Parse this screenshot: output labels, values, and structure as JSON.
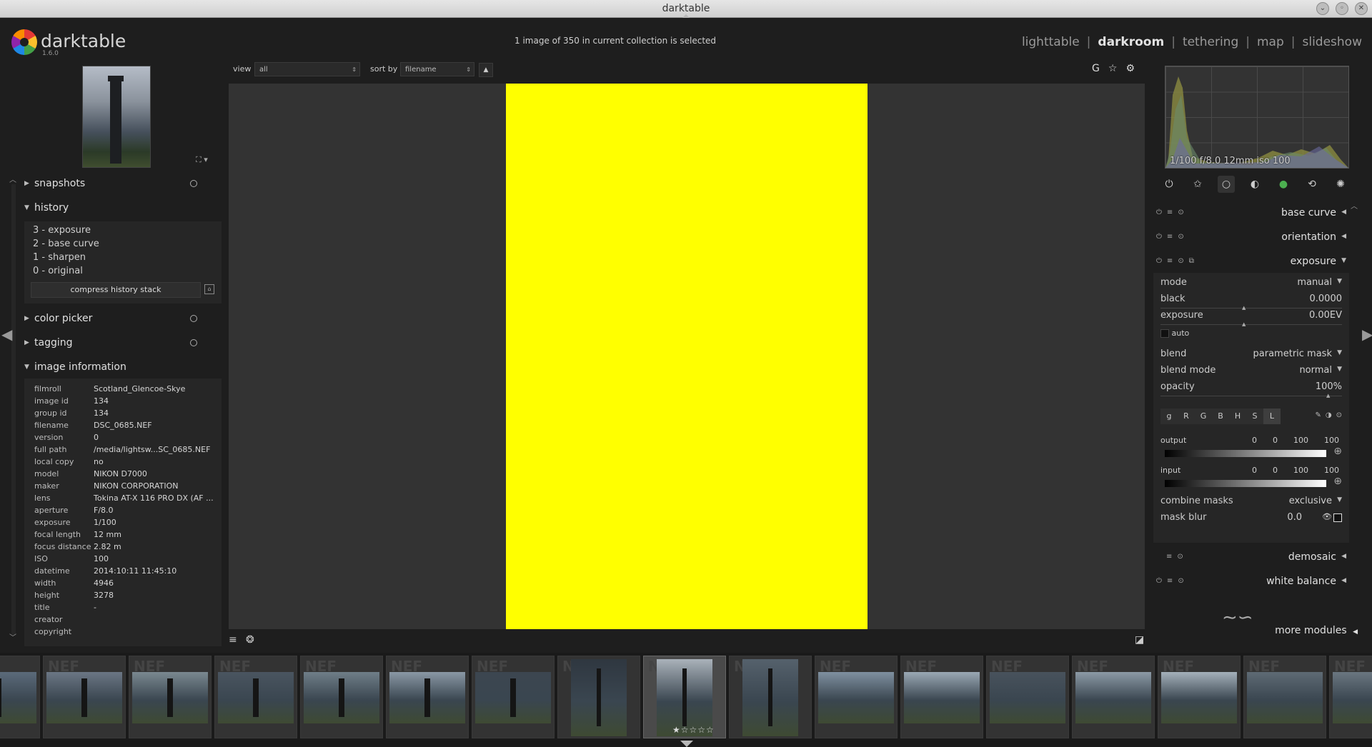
{
  "window": {
    "title": "darktable"
  },
  "app": {
    "name": "darktable",
    "version": "1.6.0"
  },
  "status_message": "1 image of 350 in current collection is selected",
  "views": [
    "lighttable",
    "darkroom",
    "tethering",
    "map",
    "slideshow"
  ],
  "active_view": "darkroom",
  "topbar": {
    "view_label": "view",
    "view_value": "all",
    "sort_label": "sort by",
    "sort_value": "filename",
    "sort_direction": "▲",
    "icons": [
      "grouping-icon",
      "star-icon",
      "gear-icon"
    ],
    "grouping_letter": "G"
  },
  "left": {
    "snapshots": "snapshots",
    "history": "history",
    "history_items": [
      "3 - exposure",
      "2 - base curve",
      "1 - sharpen",
      "0 - original"
    ],
    "compress_history": "compress history stack",
    "color_picker": "color picker",
    "tagging": "tagging",
    "image_information": "image information",
    "info": [
      [
        "filmroll",
        "Scotland_Glencoe-Skye"
      ],
      [
        "image id",
        "134"
      ],
      [
        "group id",
        "134"
      ],
      [
        "filename",
        "DSC_0685.NEF"
      ],
      [
        "version",
        "0"
      ],
      [
        "full path",
        "/media/lightsw...SC_0685.NEF"
      ],
      [
        "local copy",
        "no"
      ],
      [
        "model",
        "NIKON D7000"
      ],
      [
        "maker",
        "NIKON CORPORATION"
      ],
      [
        "lens",
        "Tokina AT-X 116 PRO DX (AF ..."
      ],
      [
        "aperture",
        "F/8.0"
      ],
      [
        "exposure",
        "1/100"
      ],
      [
        "focal length",
        "12 mm"
      ],
      [
        "focus distance",
        "2.82 m"
      ],
      [
        "ISO",
        "100"
      ],
      [
        "datetime",
        "2014:10:11 11:45:10"
      ],
      [
        "width",
        "4946"
      ],
      [
        "height",
        "3278"
      ],
      [
        "title",
        "-"
      ],
      [
        "creator",
        ""
      ],
      [
        "copyright",
        ""
      ]
    ]
  },
  "histogram": {
    "caption": "1/100 f/8.0 12mm iso 100"
  },
  "right": {
    "modules_top": [
      "base curve",
      "orientation",
      "exposure"
    ],
    "exposure": {
      "mode_label": "mode",
      "mode_value": "manual",
      "black_label": "black",
      "black_value": "0.0000",
      "exposure_label": "exposure",
      "exposure_value": "0.00EV",
      "auto_label": "auto",
      "blend_label": "blend",
      "blend_value": "parametric mask",
      "blend_mode_label": "blend mode",
      "blend_mode_value": "normal",
      "opacity_label": "opacity",
      "opacity_value": "100%",
      "channels": [
        "g",
        "R",
        "G",
        "B",
        "H",
        "S",
        "L"
      ],
      "active_channel": "L",
      "output_label": "output",
      "output_values": [
        "0",
        "0",
        "100",
        "100"
      ],
      "input_label": "input",
      "input_values": [
        "0",
        "0",
        "100",
        "100"
      ],
      "combine_masks_label": "combine masks",
      "combine_masks_value": "exclusive",
      "mask_blur_label": "mask blur",
      "mask_blur_value": "0.0"
    },
    "modules_bottom": [
      "demosaic",
      "white balance"
    ],
    "more_modules": "more modules"
  },
  "filmstrip": {
    "selected_index": 8,
    "selected_rating": "★☆☆☆☆",
    "watermark": "NEF"
  },
  "colors": {
    "canvas_image": "#ffff00",
    "canvas_background": "#333333",
    "panel_background": "#1e1e1e"
  }
}
